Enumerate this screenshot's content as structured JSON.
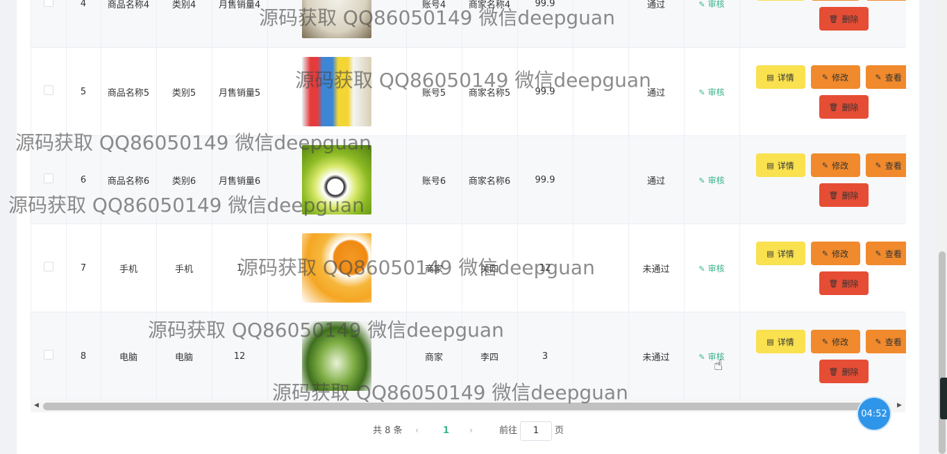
{
  "rows": [
    {
      "index": "4",
      "name": "商品名称4",
      "category": "类别4",
      "sales": "月售销量4",
      "account": "账号4",
      "merchant": "商家名称4",
      "price": "99.9",
      "status": "通过"
    },
    {
      "index": "5",
      "name": "商品名称5",
      "category": "类别5",
      "sales": "月售销量5",
      "account": "账号5",
      "merchant": "商家名称5",
      "price": "99.9",
      "status": "通过"
    },
    {
      "index": "6",
      "name": "商品名称6",
      "category": "类别6",
      "sales": "月售销量6",
      "account": "账号6",
      "merchant": "商家名称6",
      "price": "99.9",
      "status": "通过"
    },
    {
      "index": "7",
      "name": "手机",
      "category": "手机",
      "sales": "1",
      "account": "商家",
      "merchant": "关四",
      "price": "12",
      "status": "未通过"
    },
    {
      "index": "8",
      "name": "电脑",
      "category": "电脑",
      "sales": "12",
      "account": "商家",
      "merchant": "李四",
      "price": "3",
      "status": "未通过"
    }
  ],
  "actions": {
    "audit": "审核",
    "detail": "详情",
    "edit": "修改",
    "view": "查看",
    "delete": "删除"
  },
  "pagination": {
    "total": "共 8 条",
    "current": "1",
    "goto_prefix": "前往",
    "goto_value": "1",
    "goto_suffix": "页"
  },
  "timer": "04:52",
  "watermark": "源码获取 QQ86050149 微信deepguan",
  "colors": {
    "detail": "#f9e14f",
    "edit": "#f08a2c",
    "delete": "#e64d35",
    "audit": "#3db38a",
    "page_active": "#3db38a",
    "timer": "#2f95e9"
  },
  "images": [
    "bottle-image",
    "bottles-image",
    "football-image",
    "oranges-image",
    "vegetable-image"
  ]
}
